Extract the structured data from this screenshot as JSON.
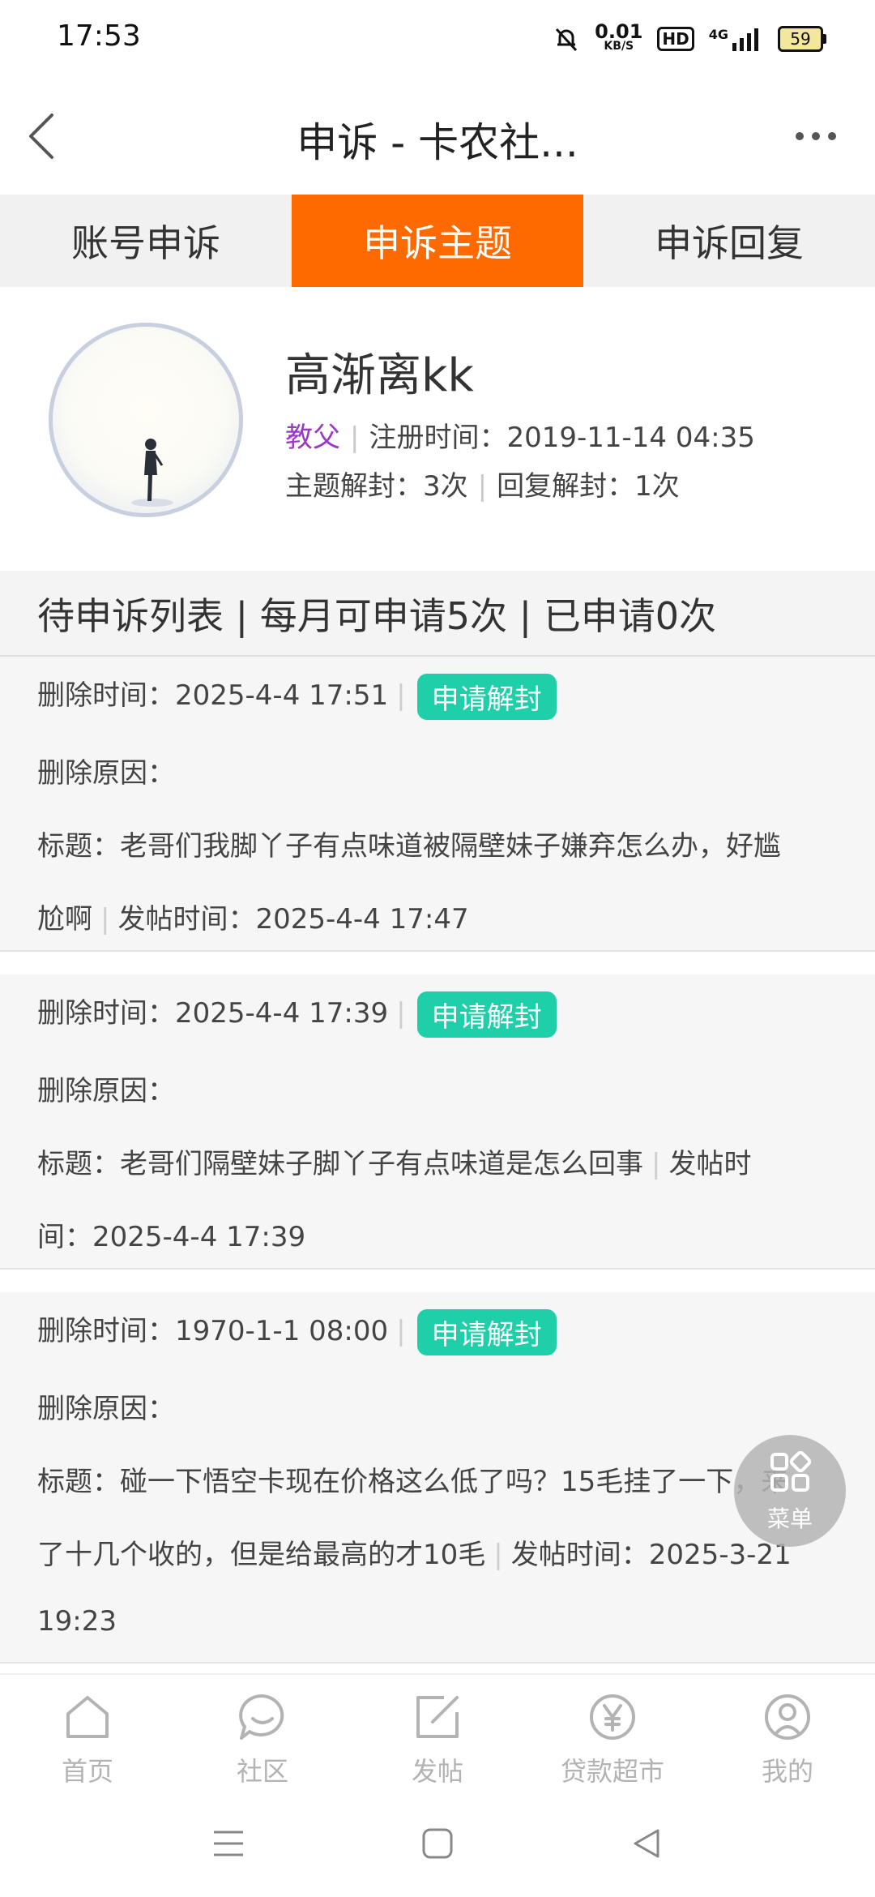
{
  "status_bar": {
    "time": "17:53",
    "speed_value": "0.01",
    "speed_unit": "KB/S",
    "hd": "HD",
    "network": "4G",
    "battery": "59"
  },
  "header": {
    "title": "申诉 - 卡农社..."
  },
  "tabs": [
    "账号申诉",
    "申诉主题",
    "申诉回复"
  ],
  "profile": {
    "username": "高渐离kk",
    "level": "教父",
    "reg_label": "注册时间：",
    "reg_time": "2019-11-14 04:35",
    "topic_unseal_label": "主题解封：",
    "topic_unseal_count": "3次",
    "reply_unseal_label": "回复解封：",
    "reply_unseal_count": "1次"
  },
  "list_header": "待申诉列表 | 每月可申请5次 | 已申请0次",
  "labels": {
    "delete_time": "删除时间：",
    "delete_reason": "删除原因：",
    "title": "标题：",
    "post_time": "发帖时间：",
    "apply_button": "申请解封"
  },
  "cards": [
    {
      "delete_time": "2025-4-4 17:51",
      "title_line1": "老哥们我脚丫子有点味道被隔壁妹子嫌弃怎么办，好尴",
      "title_line2": "尬啊",
      "post_time": "2025-4-4 17:47"
    },
    {
      "delete_time": "2025-4-4 17:39",
      "title_line1": "老哥们隔壁妹子脚丫子有点味道是怎么回事",
      "post_time_label_a": "发帖时",
      "post_time_label_b": "间：",
      "post_time": "2025-4-4 17:39"
    },
    {
      "delete_time": "1970-1-1 08:00",
      "title_line1": "碰一下悟空卡现在价格这么低了吗？15毛挂了一下，来",
      "title_line2": "了十几个收的，但是给最高的才10毛",
      "post_time_a": "2025-3-21",
      "post_time_b": "19:23"
    }
  ],
  "fab": {
    "label": "菜单"
  },
  "bottom_nav": [
    "首页",
    "社区",
    "发帖",
    "贷款超市",
    "我的"
  ]
}
